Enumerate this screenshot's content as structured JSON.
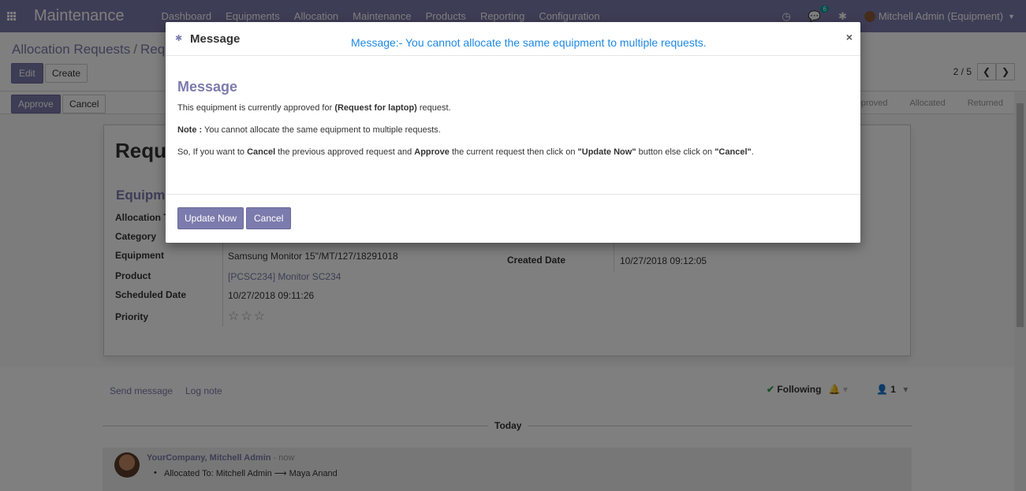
{
  "navbar": {
    "brand": "Maintenance",
    "menu": [
      "Dashboard",
      "Equipments",
      "Allocation",
      "Maintenance",
      "Products",
      "Reporting",
      "Configuration"
    ],
    "chat_count": "6",
    "user": "Mitchell Admin (Equipment)"
  },
  "control": {
    "breadcrumb_parent": "Allocation Requests",
    "breadcrumb_sep": "/",
    "breadcrumb_current": "Requ",
    "edit_label": "Edit",
    "create_label": "Create",
    "pager_value": "2 / 5"
  },
  "statusbar": {
    "approve_label": "Approve",
    "cancel_label": "Cancel",
    "stages": [
      "pproved",
      "Allocated",
      "Returned"
    ]
  },
  "form": {
    "title": "Reque",
    "section": "Equipm",
    "labels": {
      "allocation": "Allocation T",
      "category": "Category",
      "equipment": "Equipment",
      "product": "Product",
      "scheduled_date": "Scheduled Date",
      "priority": "Priority",
      "created_date": "Created Date"
    },
    "values": {
      "equipment": "Samsung Monitor 15\"/MT/127/18291018",
      "product": "[PCSC234] Monitor SC234",
      "scheduled_date": "10/27/2018 09:11:26",
      "created_date": "10/27/2018 09:12:05",
      "priority_stars": "☆☆☆"
    }
  },
  "chatter": {
    "send_message": "Send message",
    "log_note": "Log note",
    "following": "Following",
    "followers_count": "1",
    "today": "Today",
    "author": "YourCompany, Mitchell Admin",
    "time": " - now",
    "body": "Allocated To: Mitchell Admin ⟶ Maya Anand"
  },
  "modal": {
    "title": "Message",
    "banner": "Message:- You cannot allocate the same equipment to multiple requests.",
    "heading": "Message",
    "close": "×",
    "line1_pre": "This equipment is currently approved for ",
    "line1_bold": "(Request for laptop)",
    "line1_post": " request.",
    "line2_bold": "Note :",
    "line2_post": " You cannot allocate the same equipment to multiple requests.",
    "line3_a": "So, If you want to ",
    "line3_b": "Cancel",
    "line3_c": " the previous approved request and ",
    "line3_d": "Approve",
    "line3_e": " the current request then click on ",
    "line3_f": "\"Update Now\"",
    "line3_g": " button else click on ",
    "line3_h": "\"Cancel\"",
    "line3_i": ".",
    "update_label": "Update Now",
    "cancel_label": "Cancel"
  }
}
